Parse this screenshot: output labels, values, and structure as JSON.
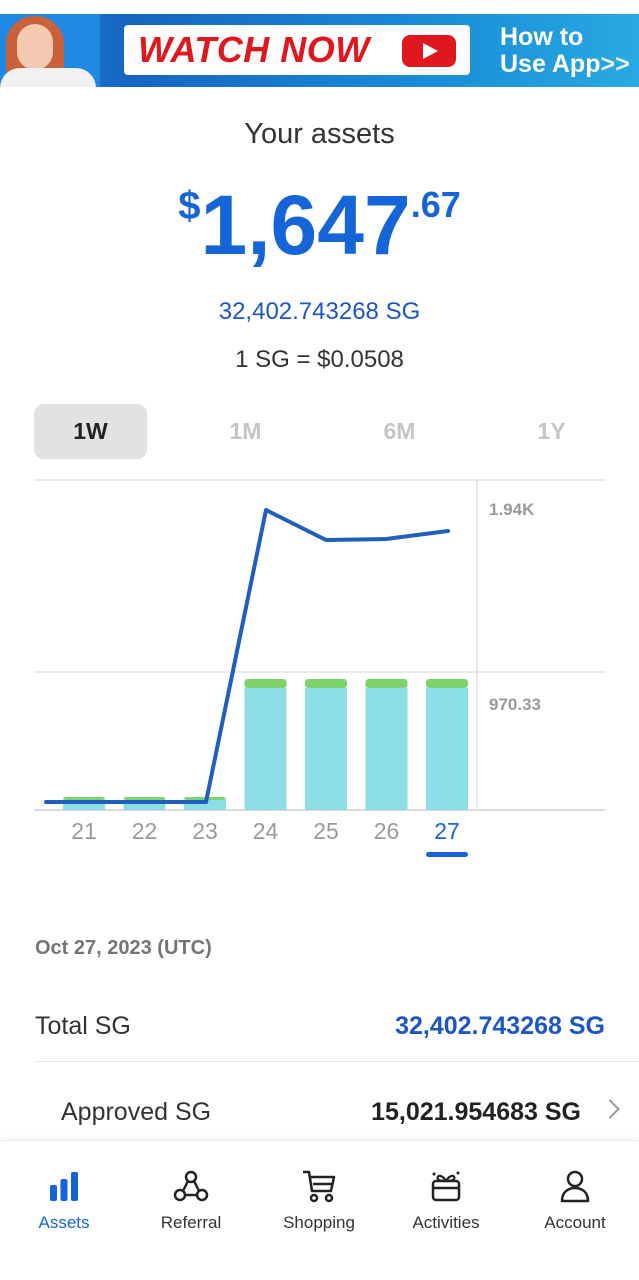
{
  "banner": {
    "cta_label": "WATCH NOW",
    "howto_line1": "How to",
    "howto_line2": "Use App",
    "howto_arrows": ">>"
  },
  "assets": {
    "title": "Your assets",
    "currency_symbol": "$",
    "amount_integer": "1,647",
    "amount_decimal": ".67",
    "sg_balance": "32,402.743268 SG",
    "rate": "1 SG = $0.0508"
  },
  "range_tabs": [
    {
      "label": "1W",
      "active": true
    },
    {
      "label": "1M",
      "active": false
    },
    {
      "label": "6M",
      "active": false
    },
    {
      "label": "1Y",
      "active": false
    }
  ],
  "chart_data": {
    "type": "bar",
    "categories": [
      "21",
      "22",
      "23",
      "24",
      "25",
      "26",
      "27"
    ],
    "selected_category": "27",
    "y_tick_labels": [
      "1.94K",
      "970.33"
    ],
    "y_ticks": [
      1940,
      970.33
    ],
    "ylim": [
      0,
      1940
    ],
    "series": [
      {
        "type": "bar",
        "values": [
          60,
          60,
          60,
          970.33,
          970.33,
          970.33,
          970.33
        ],
        "top_values": [
          10,
          10,
          10,
          50,
          50,
          50,
          50
        ],
        "color": "#8ddde7",
        "top_color": "#7ed36a"
      },
      {
        "type": "line",
        "values": [
          55,
          55,
          55,
          1780,
          1560,
          1565,
          1610
        ],
        "color": "#1f5fbf"
      }
    ],
    "grid": true
  },
  "details": {
    "date": "Oct 27, 2023 (UTC)",
    "total_label": "Total SG",
    "total_value": "32,402.743268 SG",
    "approved_label": "Approved SG",
    "approved_value": "15,021.954683 SG"
  },
  "nav": [
    {
      "label": "Assets",
      "icon": "bar-chart-icon",
      "active": true
    },
    {
      "label": "Referral",
      "icon": "referral-icon",
      "active": false
    },
    {
      "label": "Shopping",
      "icon": "cart-icon",
      "active": false
    },
    {
      "label": "Activities",
      "icon": "gift-icon",
      "active": false
    },
    {
      "label": "Account",
      "icon": "person-icon",
      "active": false
    }
  ],
  "colors": {
    "accent": "#1565d8",
    "bar_fill": "#8ddde7",
    "bar_top": "#7ed36a",
    "line": "#1f5fbf"
  }
}
